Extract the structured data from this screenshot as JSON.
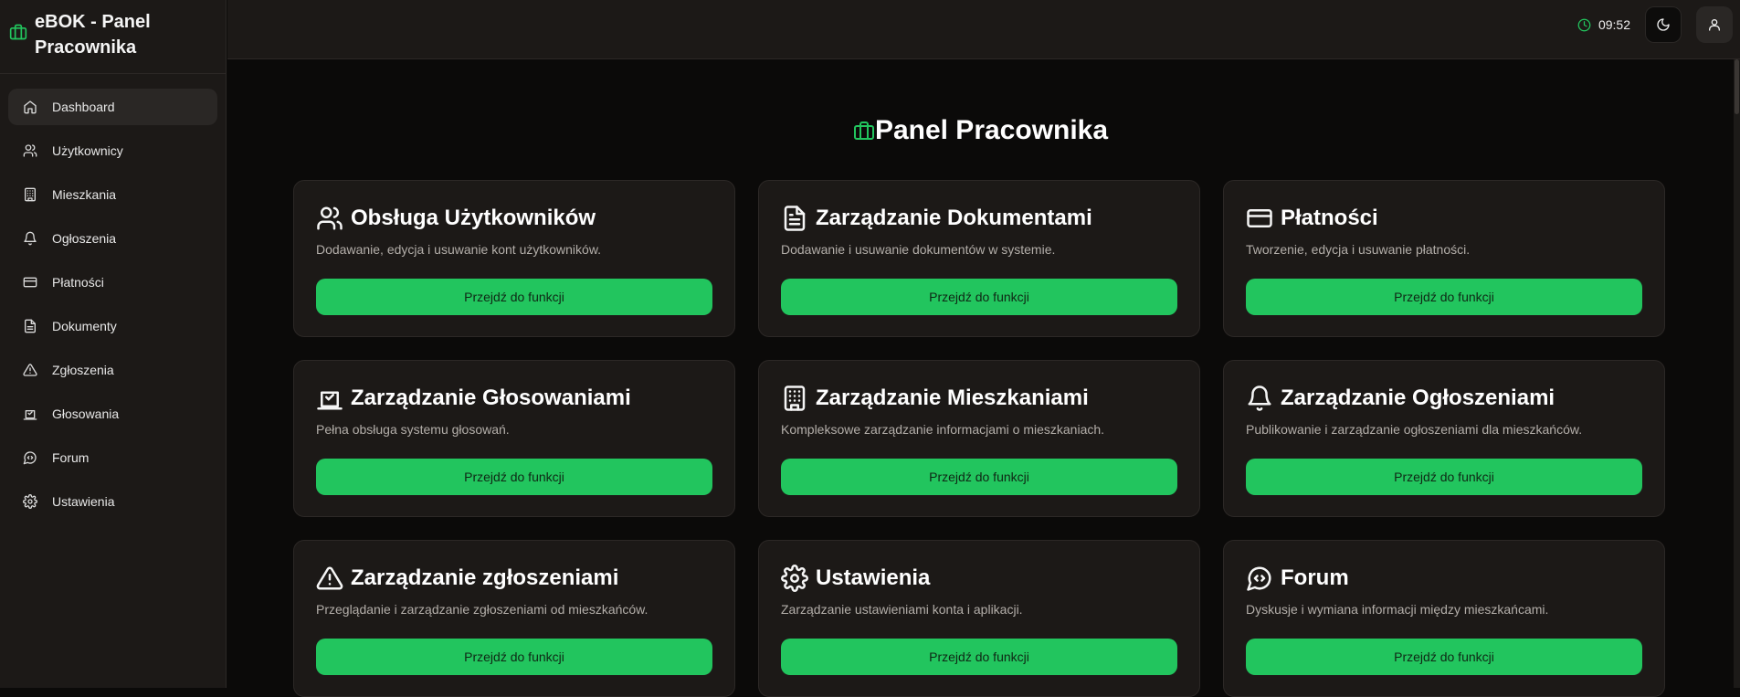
{
  "app": {
    "title": "eBOK - Panel Pracownika"
  },
  "colors": {
    "accent": "#22c55e",
    "background": "#0b0a09",
    "surface": "#1c1917"
  },
  "sidebar": {
    "items": [
      {
        "label": "Dashboard",
        "icon": "home-icon",
        "active": true
      },
      {
        "label": "Użytkownicy",
        "icon": "users-icon"
      },
      {
        "label": "Mieszkania",
        "icon": "building-icon"
      },
      {
        "label": "Ogłoszenia",
        "icon": "bell-icon"
      },
      {
        "label": "Płatności",
        "icon": "credit-card-icon"
      },
      {
        "label": "Dokumenty",
        "icon": "file-icon"
      },
      {
        "label": "Zgłoszenia",
        "icon": "alert-triangle-icon"
      },
      {
        "label": "Głosowania",
        "icon": "vote-icon"
      },
      {
        "label": "Forum",
        "icon": "message-icon"
      },
      {
        "label": "Ustawienia",
        "icon": "gear-icon"
      }
    ]
  },
  "header": {
    "time": "09:52"
  },
  "main": {
    "title": "Panel Pracownika",
    "cards": [
      {
        "title": "Obsługa Użytkowników",
        "description": "Dodawanie, edycja i usuwanie kont użytkowników.",
        "button": "Przejdź do funkcji",
        "icon": "users-icon"
      },
      {
        "title": "Zarządzanie Dokumentami",
        "description": "Dodawanie i usuwanie dokumentów w systemie.",
        "button": "Przejdź do funkcji",
        "icon": "file-icon"
      },
      {
        "title": "Płatności",
        "description": "Tworzenie, edycja i usuwanie płatności.",
        "button": "Przejdź do funkcji",
        "icon": "credit-card-icon"
      },
      {
        "title": "Zarządzanie Głosowaniami",
        "description": "Pełna obsługa systemu głosowań.",
        "button": "Przejdź do funkcji",
        "icon": "vote-icon"
      },
      {
        "title": "Zarządzanie Mieszkaniami",
        "description": "Kompleksowe zarządzanie informacjami o mieszkaniach.",
        "button": "Przejdź do funkcji",
        "icon": "building-icon"
      },
      {
        "title": "Zarządzanie Ogłoszeniami",
        "description": "Publikowanie i zarządzanie ogłoszeniami dla mieszkańców.",
        "button": "Przejdź do funkcji",
        "icon": "bell-icon"
      },
      {
        "title": "Zarządzanie zgłoszeniami",
        "description": "Przeglądanie i zarządzanie zgłoszeniami od mieszkańców.",
        "button": "Przejdź do funkcji",
        "icon": "alert-triangle-icon"
      },
      {
        "title": "Ustawienia",
        "description": "Zarządzanie ustawieniami konta i aplikacji.",
        "button": "Przejdź do funkcji",
        "icon": "gear-icon"
      },
      {
        "title": "Forum",
        "description": "Dyskusje i wymiana informacji między mieszkańcami.",
        "button": "Przejdź do funkcji",
        "icon": "message-icon"
      }
    ]
  }
}
